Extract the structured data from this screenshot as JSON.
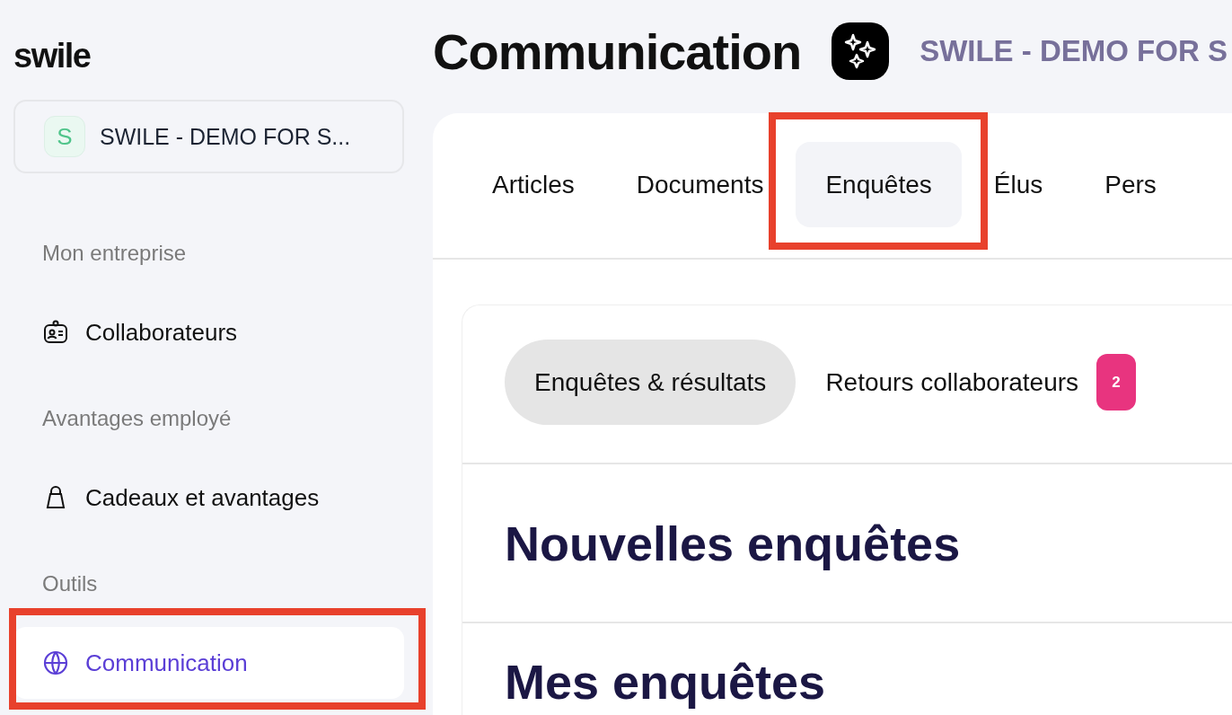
{
  "logo": "swile",
  "sidebar": {
    "organization": {
      "initial": "S",
      "name": "SWILE - DEMO FOR S..."
    },
    "sections": [
      {
        "title": "Mon entreprise",
        "items": [
          {
            "label": "Collaborateurs",
            "selected": false,
            "highlighted": false
          }
        ]
      },
      {
        "title": "Avantages employé",
        "items": [
          {
            "label": "Cadeaux et avantages",
            "selected": false,
            "highlighted": false
          }
        ]
      },
      {
        "title": "Outils",
        "items": [
          {
            "label": "Communication",
            "selected": true,
            "highlighted": true
          }
        ]
      }
    ]
  },
  "header": {
    "title": "Communication",
    "company": "SWILE - DEMO FOR S"
  },
  "tabs": [
    {
      "label": "Articles",
      "selected": false,
      "highlighted": false
    },
    {
      "label": "Documents",
      "selected": false,
      "highlighted": false
    },
    {
      "label": "Enquêtes",
      "selected": true,
      "highlighted": true
    },
    {
      "label": "Élus",
      "selected": false,
      "highlighted": false
    },
    {
      "label": "Pers",
      "selected": false,
      "highlighted": false
    }
  ],
  "subtabs": [
    {
      "label": "Enquêtes & résultats",
      "selected": true
    },
    {
      "label": "Retours collaborateurs",
      "selected": false,
      "badge": "2"
    }
  ],
  "headings": [
    "Nouvelles enquêtes",
    "Mes enquêtes"
  ]
}
